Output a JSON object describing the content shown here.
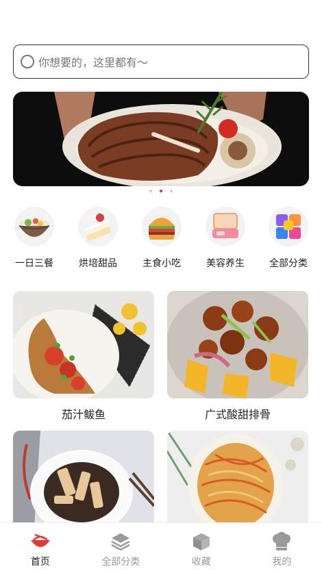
{
  "search": {
    "placeholder": "你想要的，这里都有～"
  },
  "banner": {
    "dots": 3,
    "active_dot": 1
  },
  "categories": [
    {
      "label": "一日三餐",
      "icon": "noodle-bowl-icon"
    },
    {
      "label": "烘培甜品",
      "icon": "cake-icon"
    },
    {
      "label": "主食小吃",
      "icon": "burger-icon"
    },
    {
      "label": "美容养生",
      "icon": "lunchbox-icon"
    },
    {
      "label": "全部分类",
      "icon": "cubes-icon"
    }
  ],
  "recipes": [
    {
      "title": "茄汁鲅鱼"
    },
    {
      "title": "广式酸甜排骨"
    },
    {
      "title": ""
    },
    {
      "title": ""
    }
  ],
  "tabs": [
    {
      "label": "首页",
      "icon": "bowl-icon",
      "active": true
    },
    {
      "label": "全部分类",
      "icon": "layers-icon",
      "active": false
    },
    {
      "label": "收藏",
      "icon": "box-icon",
      "active": false
    },
    {
      "label": "我的",
      "icon": "chef-hat-icon",
      "active": false
    }
  ],
  "colors": {
    "accent": "#e53935",
    "inactive": "#9a9a9a"
  }
}
